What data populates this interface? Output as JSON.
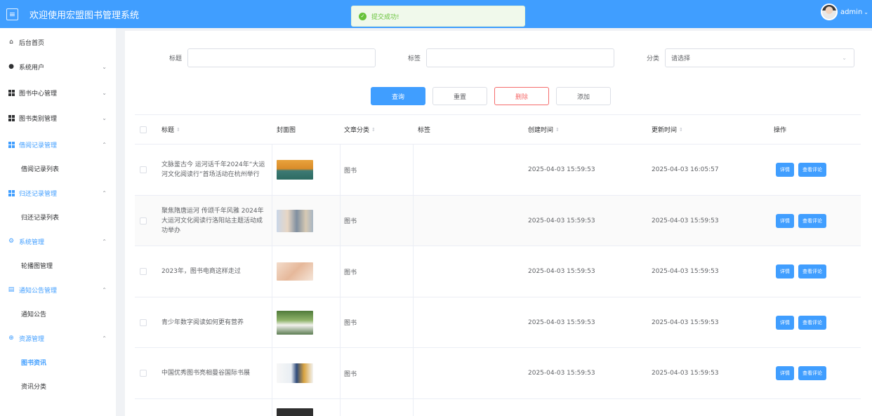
{
  "header": {
    "title": "欢迎使用宏盟图书管理系统",
    "username": "admin",
    "color": "#409eff"
  },
  "toast": {
    "message": "提交成功!"
  },
  "sidebar": {
    "items": [
      {
        "label": "后台首页"
      },
      {
        "label": "系统用户"
      },
      {
        "label": "图书中心管理"
      },
      {
        "label": "图书类别管理"
      },
      {
        "label": "借阅记录管理"
      },
      {
        "label": "借阅记录列表"
      },
      {
        "label": "归还记录管理"
      },
      {
        "label": "归还记录列表"
      },
      {
        "label": "系统管理"
      },
      {
        "label": "轮播图管理"
      },
      {
        "label": "通知公告管理"
      },
      {
        "label": "通知公告"
      },
      {
        "label": "资源管理"
      },
      {
        "label": "图书资讯"
      },
      {
        "label": "资讯分类"
      }
    ]
  },
  "filters": {
    "title_label": "标题",
    "tag_label": "标签",
    "category_label": "分类",
    "category_placeholder": "请选择"
  },
  "buttons": {
    "query": "查询",
    "reset": "重置",
    "delete": "删除",
    "add": "添加"
  },
  "table": {
    "columns": [
      "标题",
      "封面图",
      "文章分类",
      "标签",
      "创建时间",
      "更新时间",
      "操作"
    ],
    "rows": [
      {
        "title": "文脉鉴古今 运河话千年2024年“大运河文化阅读行”首场活动在杭州举行",
        "category": "图书",
        "tag": "",
        "created": "2025-04-03 15:59:53",
        "updated": "2025-04-03 16:05:57"
      },
      {
        "title": "聚焦隋唐运河 传颂千年风雅 2024年大运河文化阅读行洛阳站主题活动成功举办",
        "category": "图书",
        "tag": "",
        "created": "2025-04-03 15:59:53",
        "updated": "2025-04-03 15:59:53"
      },
      {
        "title": "2023年，图书电商这样走过",
        "category": "图书",
        "tag": "",
        "created": "2025-04-03 15:59:53",
        "updated": "2025-04-03 15:59:53"
      },
      {
        "title": "青少年数字阅读如何更有营养",
        "category": "图书",
        "tag": "",
        "created": "2025-04-03 15:59:53",
        "updated": "2025-04-03 15:59:53"
      },
      {
        "title": "中国优秀图书亮相曼谷国际书展",
        "category": "图书",
        "tag": "",
        "created": "2025-04-03 15:59:53",
        "updated": "2025-04-03 15:59:53"
      }
    ],
    "detail_label": "详情",
    "comments_label": "查看评论"
  }
}
